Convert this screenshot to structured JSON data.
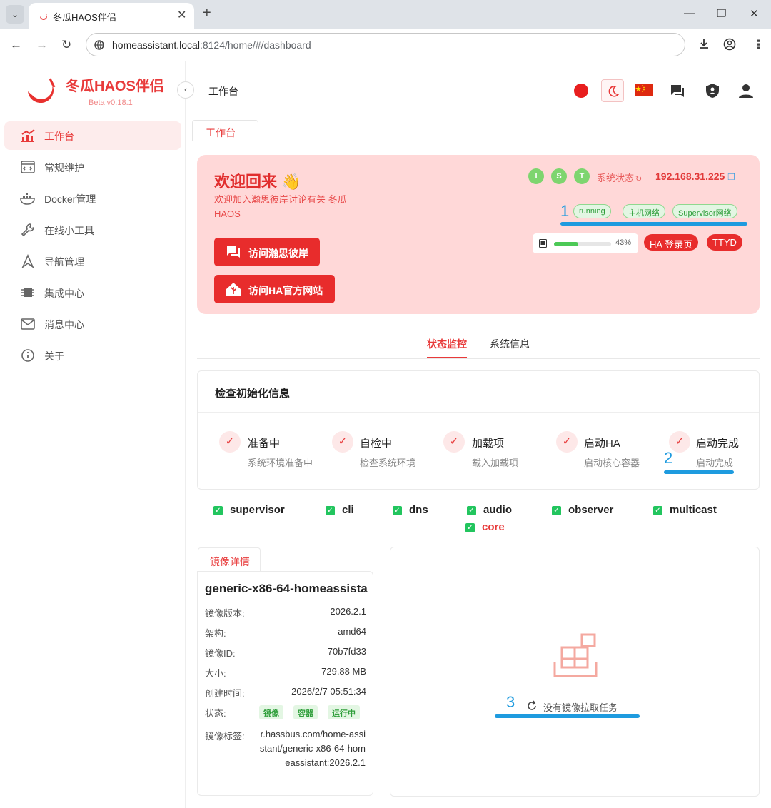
{
  "browser": {
    "tab_title": "冬瓜HAOS伴侣",
    "url_host": "homeassistant.local",
    "url_rest": ":8124/home/#/dashboard"
  },
  "sidebar": {
    "brand": "冬瓜HAOS伴侣",
    "version": "Beta   v0.18.1",
    "items": [
      {
        "label": "工作台",
        "icon": "dashboard-chart-icon",
        "active": true
      },
      {
        "label": "常规维护",
        "icon": "maintenance-icon"
      },
      {
        "label": "Docker管理",
        "icon": "docker-icon"
      },
      {
        "label": "在线小工具",
        "icon": "wrench-icon"
      },
      {
        "label": "导航管理",
        "icon": "navigation-icon"
      },
      {
        "label": "集成中心",
        "icon": "chip-icon"
      },
      {
        "label": "消息中心",
        "icon": "mail-icon"
      },
      {
        "label": "关于",
        "icon": "info-icon"
      }
    ]
  },
  "header": {
    "title": "工作台",
    "page_tab": "工作台"
  },
  "banner": {
    "welcome": "欢迎回来 👋",
    "subtitle": "欢迎加入瀚思彼岸讨论有关 冬瓜HAOS",
    "btn_forum": "访问瀚思彼岸",
    "btn_ha": "访问HA官方网站",
    "status_dots": [
      "I",
      "S",
      "T"
    ],
    "system_status": "系统状态",
    "ip": "192.168.31.225",
    "chips": [
      "running",
      "主机网络",
      "Supervisor网络"
    ],
    "disk_percent": 43,
    "disk_percent_label": "43%",
    "ha_login": "HA 登录页",
    "ttyd": "TTYD"
  },
  "annotations": [
    "1",
    "2",
    "3"
  ],
  "subtabs": [
    "状态监控",
    "系统信息"
  ],
  "init": {
    "title": "检查初始化信息",
    "steps": [
      {
        "title": "准备中",
        "desc": "系统环境准备中"
      },
      {
        "title": "自检中",
        "desc": "检查系统环境"
      },
      {
        "title": "加载项",
        "desc": "载入加载项"
      },
      {
        "title": "启动HA",
        "desc": "启动核心容器"
      },
      {
        "title": "启动完成",
        "desc": "启动完成"
      }
    ]
  },
  "services": [
    "supervisor",
    "cli",
    "dns",
    "audio",
    "observer",
    "multicast",
    "core"
  ],
  "image": {
    "tab": "镜像详情",
    "name": "generic-x86-64-homeassistant",
    "rows": [
      {
        "k": "镜像版本:",
        "v": "2026.2.1"
      },
      {
        "k": "架构:",
        "v": "amd64"
      },
      {
        "k": "镜像ID:",
        "v": "70b7fd33"
      },
      {
        "k": "大小:",
        "v": "729.88 MB"
      },
      {
        "k": "创建时间:",
        "v": "2026/2/7 05:51:34"
      }
    ],
    "status_label": "状态:",
    "status_tags": [
      "镜像",
      "容器",
      "运行中"
    ],
    "tag_label": "镜像标签:",
    "tag_value": "r.hassbus.com/home-assistant/generic-x86-64-homeassistant:2026.2.1"
  },
  "pull": {
    "empty_text": "没有镜像拉取任务"
  },
  "colors": {
    "accent": "#e83a3a",
    "green": "#22c55e",
    "annotation": "#1e9bdf"
  }
}
